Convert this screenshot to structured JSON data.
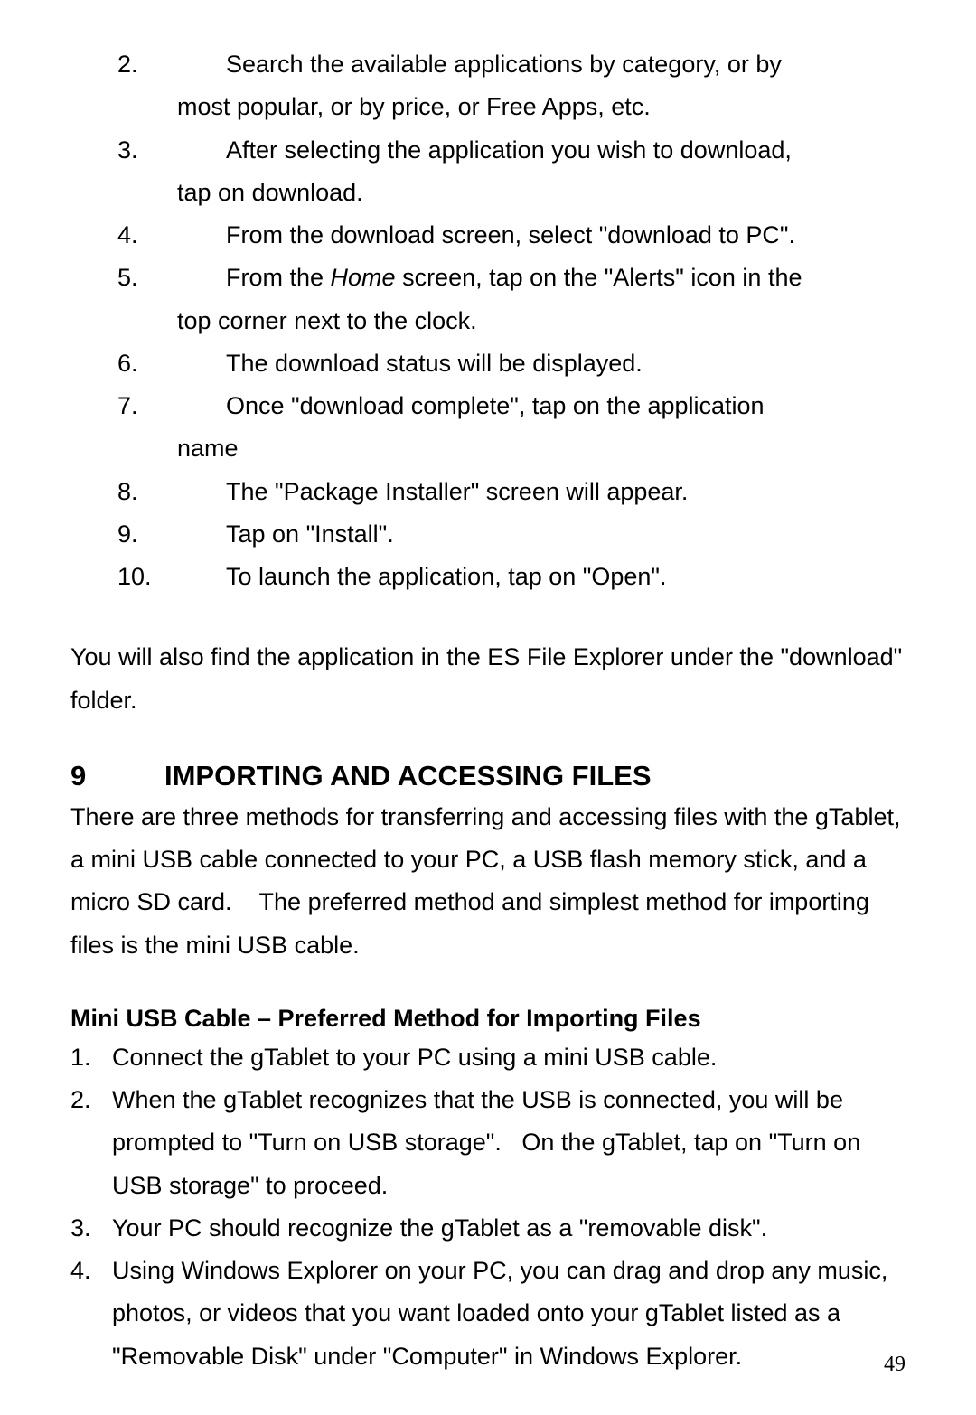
{
  "list1": {
    "items": [
      {
        "num": "2.",
        "text": "Search the available applications by category, or by",
        "cont": "most popular, or by price, or Free Apps, etc."
      },
      {
        "num": "3.",
        "text": "After selecting the application you wish to download,",
        "cont": "tap on download."
      },
      {
        "num": "4.",
        "text": "From the download screen, select \"download to PC\"."
      },
      {
        "num": "5.",
        "text_before": "From the ",
        "text_italic": "Home",
        "text_after": " screen, tap on the \"Alerts\" icon in the",
        "cont": "top corner next to the clock."
      },
      {
        "num": "6.",
        "text": "The download status will be displayed."
      },
      {
        "num": "7.",
        "text": "Once \"download complete\", tap on the application",
        "cont": "name"
      },
      {
        "num": "8.",
        "text": "The \"Package Installer\" screen will appear."
      },
      {
        "num": "9.",
        "text": "Tap on \"Install\"."
      },
      {
        "num": "10.",
        "text": "To launch the application, tap on \"Open\"."
      }
    ]
  },
  "paragraph1": "You will also find the application in the ES File Explorer under the \"download\" folder.",
  "heading": {
    "section_num": "9",
    "title": "IMPORTING AND ACCESSING FILES"
  },
  "intro": "There are three methods for transferring and accessing files with the gTablet, a mini USB cable connected to your PC, a USB flash memory stick, and a micro SD card.    The preferred method and simplest method for importing files is the mini USB cable.",
  "subheading": "Mini USB Cable – Preferred Method for Importing Files",
  "list2": {
    "items": [
      {
        "num": "1.",
        "text": "Connect the gTablet to your PC using a mini USB cable."
      },
      {
        "num": "2.",
        "text": "When the gTablet recognizes that the USB is connected, you will be prompted to \"Turn on USB storage\".   On the gTablet, tap on \"Turn on USB storage\" to proceed."
      },
      {
        "num": "3.",
        "text": "Your PC should recognize the gTablet as a \"removable disk\"."
      },
      {
        "num": "4.",
        "text": "Using Windows Explorer on your PC, you can drag and drop any music, photos, or videos that you want loaded onto your gTablet listed as a \"Removable Disk\" under \"Computer\" in Windows Explorer."
      }
    ]
  },
  "page_number": "49"
}
